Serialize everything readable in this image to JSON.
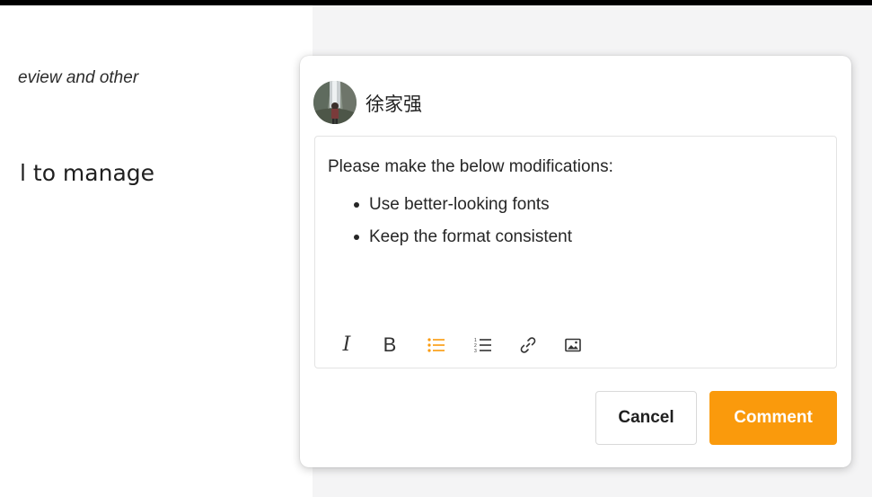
{
  "background_document": {
    "italic_snippet": "eview and other",
    "heading_snippet": "l to manage"
  },
  "comment_popover": {
    "user": {
      "name": "徐家强",
      "avatar_icon": "user-photo-avatar"
    },
    "editor": {
      "intro": "Please make the below modifications:",
      "bullets": [
        "Use better-looking fonts",
        "Keep the format consistent"
      ]
    },
    "toolbar": {
      "items": [
        {
          "name": "italic",
          "label": "I"
        },
        {
          "name": "bold",
          "label": "B"
        },
        {
          "name": "bulleted-list",
          "icon": "bulleted-list-icon",
          "active": true
        },
        {
          "name": "numbered-list",
          "icon": "numbered-list-icon"
        },
        {
          "name": "link",
          "icon": "link-icon"
        },
        {
          "name": "image",
          "icon": "image-icon"
        }
      ]
    },
    "actions": {
      "cancel_label": "Cancel",
      "comment_label": "Comment"
    },
    "colors": {
      "accent": "#fa9a0c",
      "text": "#262626",
      "border": "#e3e3e3"
    }
  }
}
